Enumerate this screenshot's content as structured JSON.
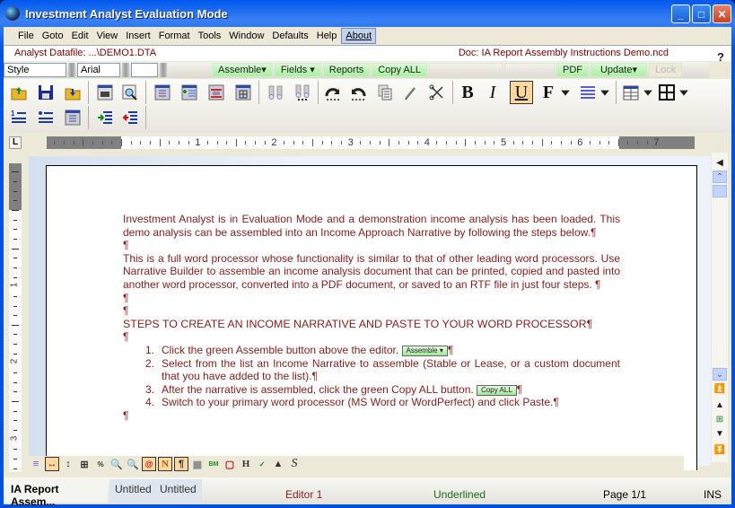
{
  "window": {
    "title": "Investment Analyst Evaluation Mode",
    "controls": {
      "minimize": "_",
      "maximize": "□",
      "close": "✕"
    }
  },
  "menu": {
    "items": [
      "File",
      "Goto",
      "Edit",
      "View",
      "Insert",
      "Format",
      "Tools",
      "Window",
      "Defaults",
      "Help",
      "About"
    ],
    "active": "About"
  },
  "info": {
    "datafile": "Analyst Datafile: ...\\DEMO1.DTA",
    "document": "Doc: IA Report Assembly Instructions Demo.ncd",
    "help": "?"
  },
  "formatbar": {
    "style": "Style",
    "font": "Arial",
    "size": "",
    "assemble": "Assemble▾",
    "fields": "Fields  ▾",
    "reports": "Reports",
    "copy_all": "Copy ALL",
    "pdf": "PDF",
    "update": "Update▾",
    "lock": "Lock"
  },
  "toolbar": {
    "bold": "B",
    "italic": "I",
    "underline": "U",
    "font": "F",
    "underline_active": true
  },
  "ruler": {
    "tab_marker": "L",
    "numbers": [
      "1",
      "2",
      "3",
      "4",
      "5",
      "6",
      "7"
    ],
    "vertical_numbers": [
      "1",
      "2",
      "3"
    ]
  },
  "document": {
    "para1": "Investment Analyst is in Evaluation Mode and a demonstration income analysis has been loaded.  This demo analysis can be assembled into an Income Approach Narrative by following the steps below.¶",
    "para2": "This is a full word processor whose functionality is similar to that of other leading word processors.  Use Narrative Builder to assemble an income analysis document that can be printed, copied and pasted into another word processor, converted into a PDF document, or saved to an RTF file in just four steps.  ¶",
    "pilcrow": "¶",
    "heading": "STEPS TO CREATE AN INCOME NARRATIVE AND PASTE TO YOUR WORD PROCESSOR¶",
    "steps": [
      {
        "num": "1.",
        "text": "Click the green Assemble button above the editor. ",
        "button": "Assemble ▾",
        "end": "¶"
      },
      {
        "num": "2.",
        "text": "Select from the list an Income Narrative to assemble (Stable or Lease, or a custom document that you have added to the list).¶"
      },
      {
        "num": "3.",
        "text": "After the narrative is assembled, click the green Copy ALL button. ",
        "button": "Copy ALL",
        "end": "¶"
      },
      {
        "num": "4.",
        "text": "Switch to your primary word processor (MS Word or WordPerfect) and click Paste.¶"
      }
    ]
  },
  "bottom_toolbar": {
    "n_label": "N",
    "pilcrow_label": "¶",
    "h_label": "H",
    "s_label": "S"
  },
  "status": {
    "tabs": [
      "IA Report Assem...",
      "Untitled",
      "Untitled"
    ],
    "editor": "Editor 1",
    "format": "Underlined",
    "page": "Page 1/1",
    "mode": "INS"
  },
  "colors": {
    "doc_text": "#8b1a1a",
    "green_button": "#a8f09f",
    "status_format": "#1a6b1a"
  }
}
